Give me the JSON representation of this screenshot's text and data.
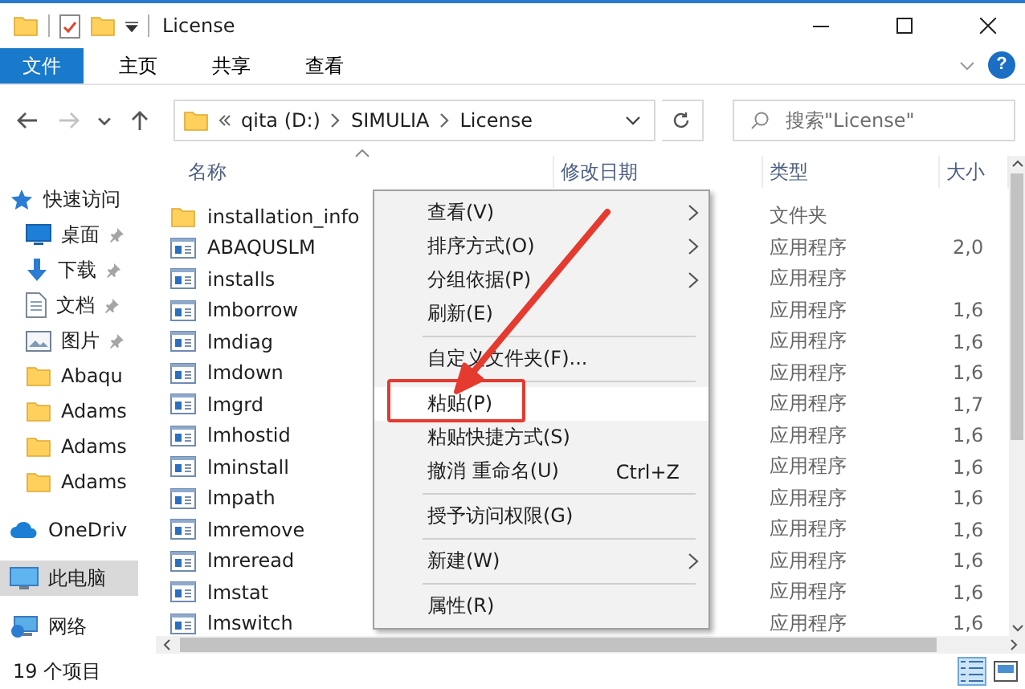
{
  "window": {
    "title": "License"
  },
  "ribbon": {
    "tabs": [
      {
        "label": "文件",
        "kind": "file"
      },
      {
        "label": "主页",
        "kind": "tab"
      },
      {
        "label": "共享",
        "kind": "tab"
      },
      {
        "label": "查看",
        "kind": "tab"
      }
    ],
    "help": "?"
  },
  "nav": [
    {
      "kind": "back",
      "disabled": false
    },
    {
      "kind": "forward",
      "disabled": true
    },
    {
      "kind": "recent",
      "disabled": false
    },
    {
      "kind": "up",
      "disabled": false
    }
  ],
  "address": {
    "segments": [
      "qita (D:)",
      "SIMULIA",
      "License"
    ]
  },
  "search": {
    "placeholder": "搜索\"License\""
  },
  "sidebar": {
    "items": [
      {
        "label": "快速访问",
        "kind": "star",
        "pinned": false,
        "selected": false,
        "children": [
          {
            "label": "桌面",
            "kind": "desktop",
            "pinned": true,
            "selected": false
          },
          {
            "label": "下载",
            "kind": "download",
            "pinned": true,
            "selected": false
          },
          {
            "label": "文档",
            "kind": "document",
            "pinned": true,
            "selected": false
          },
          {
            "label": "图片",
            "kind": "pictures",
            "pinned": true,
            "selected": false
          },
          {
            "label": "Abaqu",
            "kind": "folder",
            "pinned": false,
            "selected": false
          },
          {
            "label": "Adams",
            "kind": "folder",
            "pinned": false,
            "selected": false
          },
          {
            "label": "Adams",
            "kind": "folder",
            "pinned": false,
            "selected": false
          },
          {
            "label": "Adams",
            "kind": "folder",
            "pinned": false,
            "selected": false
          }
        ]
      },
      {
        "label": "OneDriv",
        "kind": "cloud",
        "pinned": false,
        "selected": false
      },
      {
        "label": "此电脑",
        "kind": "pc",
        "pinned": false,
        "selected": true
      },
      {
        "label": "网络",
        "kind": "network",
        "pinned": false,
        "selected": false
      }
    ]
  },
  "table": {
    "columns": [
      {
        "label": "名称",
        "sorted": true
      },
      {
        "label": "修改日期",
        "sorted": false
      },
      {
        "label": "类型",
        "sorted": false
      },
      {
        "label": "大小",
        "sorted": false
      }
    ],
    "rows": [
      {
        "name": "installation_info",
        "kind": "folder",
        "type": "文件夹"
      },
      {
        "name": "ABAQUSLM",
        "kind": "app",
        "type": "应用程序",
        "size": "2,0"
      },
      {
        "name": "installs",
        "kind": "app",
        "type": "应用程序"
      },
      {
        "name": "lmborrow",
        "kind": "app",
        "type": "应用程序",
        "size": "1,6"
      },
      {
        "name": "lmdiag",
        "kind": "app",
        "type": "应用程序",
        "size": "1,6"
      },
      {
        "name": "lmdown",
        "kind": "app",
        "type": "应用程序",
        "size": "1,6"
      },
      {
        "name": "lmgrd",
        "kind": "app",
        "type": "应用程序",
        "size": "1,7"
      },
      {
        "name": "lmhostid",
        "kind": "app",
        "type": "应用程序",
        "size": "1,6"
      },
      {
        "name": "lminstall",
        "kind": "app",
        "type": "应用程序",
        "size": "1,6"
      },
      {
        "name": "lmpath",
        "kind": "app",
        "type": "应用程序",
        "size": "1,6"
      },
      {
        "name": "lmremove",
        "kind": "app",
        "type": "应用程序",
        "size": "1,6"
      },
      {
        "name": "lmreread",
        "kind": "app",
        "type": "应用程序",
        "size": "1,6"
      },
      {
        "name": "lmstat",
        "kind": "app",
        "type": "应用程序",
        "size": "1,6"
      },
      {
        "name": "lmswitch",
        "kind": "app",
        "type": "应用程序",
        "size": "1,6"
      }
    ]
  },
  "context_menu": {
    "items": [
      {
        "kind": "item",
        "label": "查看(V)",
        "submenu": true,
        "highlighted": false,
        "boxed": false
      },
      {
        "kind": "item",
        "label": "排序方式(O)",
        "submenu": true,
        "highlighted": false,
        "boxed": false
      },
      {
        "kind": "item",
        "label": "分组依据(P)",
        "submenu": true,
        "highlighted": false,
        "boxed": false
      },
      {
        "kind": "item",
        "label": "刷新(E)",
        "submenu": false,
        "highlighted": false,
        "boxed": false
      },
      {
        "kind": "separator"
      },
      {
        "kind": "item",
        "label": "自定义文件夹(F)...",
        "submenu": false,
        "highlighted": false,
        "boxed": false
      },
      {
        "kind": "separator"
      },
      {
        "kind": "item",
        "label": "粘贴(P)",
        "submenu": false,
        "highlighted": true,
        "boxed": true
      },
      {
        "kind": "item",
        "label": "粘贴快捷方式(S)",
        "submenu": false,
        "highlighted": false,
        "boxed": false
      },
      {
        "kind": "item",
        "label": "撤消 重命名(U)",
        "shortcut": "Ctrl+Z",
        "submenu": false,
        "highlighted": false,
        "boxed": false
      },
      {
        "kind": "separator"
      },
      {
        "kind": "item",
        "label": "授予访问权限(G)",
        "submenu": false,
        "highlighted": false,
        "boxed": false
      },
      {
        "kind": "separator"
      },
      {
        "kind": "item",
        "label": "新建(W)",
        "submenu": true,
        "highlighted": false,
        "boxed": false
      },
      {
        "kind": "separator"
      },
      {
        "kind": "item",
        "label": "属性(R)",
        "submenu": false,
        "highlighted": false,
        "boxed": false
      }
    ]
  },
  "annotations": [
    {
      "kind": "arrow"
    }
  ],
  "status": {
    "count": "19 个项目",
    "views": [
      {
        "kind": "details",
        "selected": true
      },
      {
        "kind": "tiles",
        "selected": false
      }
    ]
  }
}
